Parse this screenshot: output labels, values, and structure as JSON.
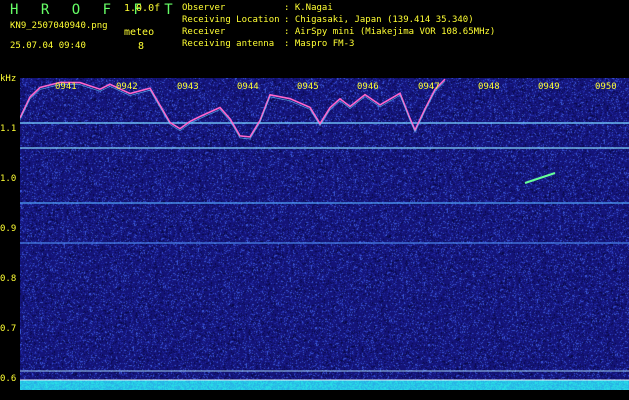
{
  "header": {
    "logo": "H R O F F T",
    "version": "1.0.0f",
    "filename": "KN9_2507040940.png",
    "meteo_label": "meteo",
    "datetime": "25.07.04 09:40",
    "meteo_count": "8",
    "info": [
      {
        "label": "Observer",
        "value": ": K.Nagai"
      },
      {
        "label": "Receiving Location",
        "value": ": Chigasaki, Japan (139.414 35.340)"
      },
      {
        "label": "Receiver",
        "value": ": AirSpy mini (Miakejima VOR 108.65MHz)"
      },
      {
        "label": "Receiving antenna",
        "value": ": Maspro FM-3"
      }
    ]
  },
  "axis": {
    "unit": "kHz",
    "y_ticks": [
      "1.1",
      "1.0",
      "0.9",
      "0.8",
      "0.7",
      "0.6"
    ],
    "time_ticks": [
      "0941",
      "0942",
      "0943",
      "0944",
      "0945",
      "0946",
      "0947",
      "0948",
      "0949",
      "0950"
    ]
  },
  "colors": {
    "background": "#1a1a8c",
    "axis_text": "#ffff33",
    "logo": "#66ff66",
    "trace": "#ff66cc",
    "carrier": "#66ccff"
  }
}
